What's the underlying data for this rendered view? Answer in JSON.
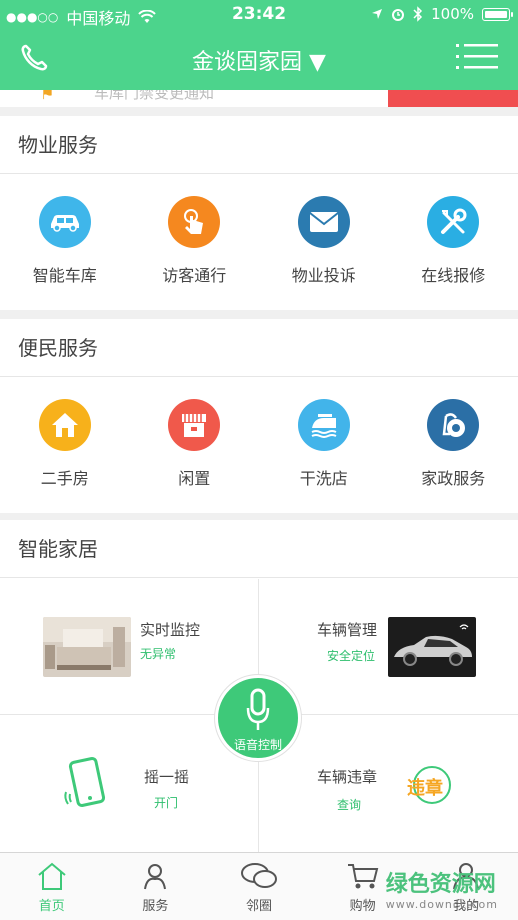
{
  "status": {
    "signal": "●●●○○",
    "carrier": "中国移动",
    "time": "23:42",
    "battery": "100%"
  },
  "header": {
    "title": "金谈固家园 ▼"
  },
  "banner": {
    "text": "车库门禁变更通知"
  },
  "property": {
    "title": "物业服务",
    "items": [
      {
        "label": "智能车库",
        "icon": "car-icon",
        "color": "#3fb6ea"
      },
      {
        "label": "访客通行",
        "icon": "tap-icon",
        "color": "#f5881f"
      },
      {
        "label": "物业投诉",
        "icon": "mail-icon",
        "color": "#2b7bb0"
      },
      {
        "label": "在线报修",
        "icon": "tools-icon",
        "color": "#2aaee3"
      }
    ]
  },
  "convenience": {
    "title": "便民服务",
    "items": [
      {
        "label": "二手房",
        "icon": "house-icon",
        "color": "#f7b11b"
      },
      {
        "label": "闲置",
        "icon": "store-icon",
        "color": "#f0594b"
      },
      {
        "label": "干洗店",
        "icon": "iron-icon",
        "color": "#42b4ea"
      },
      {
        "label": "家政服务",
        "icon": "vacuum-icon",
        "color": "#2b6fa6"
      }
    ]
  },
  "smart": {
    "title": "智能家居",
    "monitor": {
      "title": "实时监控",
      "sub": "无异常"
    },
    "vehicle": {
      "title": "车辆管理",
      "sub": "安全定位"
    },
    "shake": {
      "title": "摇一摇",
      "sub": "开门"
    },
    "violation": {
      "title": "车辆违章",
      "sub": "查询"
    },
    "violation_badge": "违章",
    "voice": "语音控制"
  },
  "tabs": [
    {
      "label": "首页",
      "icon": "home-icon"
    },
    {
      "label": "服务",
      "icon": "service-icon"
    },
    {
      "label": "邻圈",
      "icon": "chat-icon"
    },
    {
      "label": "购物",
      "icon": "cart-icon"
    },
    {
      "label": "我的",
      "icon": "user-icon"
    }
  ],
  "watermark": {
    "name": "绿色资源网",
    "url": "www.downcc.com"
  },
  "colors": {
    "primary": "#4cd48c",
    "accent": "#3ec979",
    "text": "#444444"
  }
}
